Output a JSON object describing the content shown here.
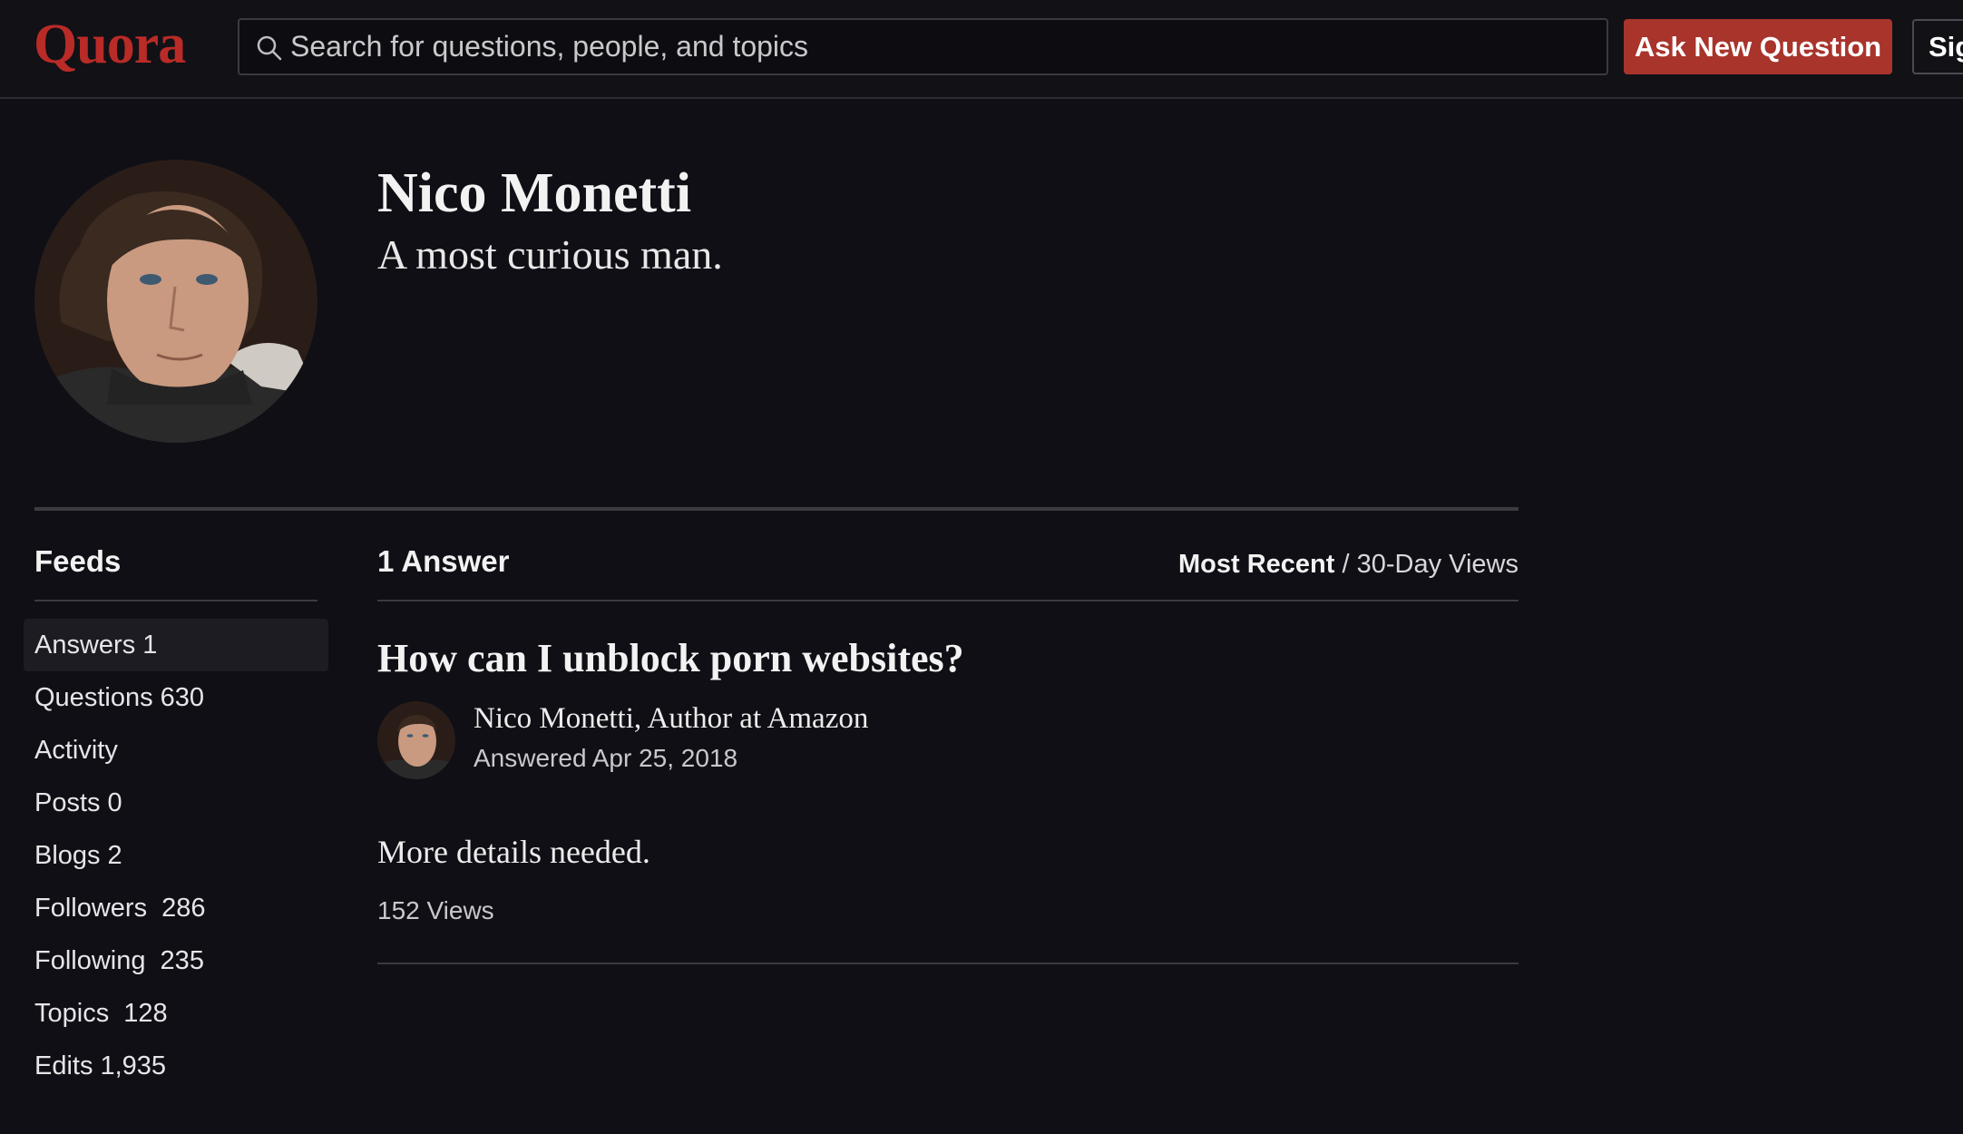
{
  "header": {
    "logo": "Quora",
    "search_placeholder": "Search for questions, people, and topics",
    "ask_button": "Ask New Question",
    "signin_button": "Sign In"
  },
  "profile": {
    "name": "Nico Monetti",
    "tagline": "A most curious man."
  },
  "feeds": {
    "title": "Feeds",
    "items": [
      {
        "label": "Answers",
        "count": "1",
        "active": true
      },
      {
        "label": "Questions",
        "count": "630"
      },
      {
        "label": "Activity",
        "count": ""
      },
      {
        "label": "Posts",
        "count": "0"
      },
      {
        "label": "Blogs",
        "count": "2"
      },
      {
        "label": "Followers",
        "count": " 286"
      },
      {
        "label": "Following",
        "count": " 235"
      },
      {
        "label": "Topics",
        "count": " 128"
      },
      {
        "label": "Edits",
        "count": "1,935"
      }
    ]
  },
  "content": {
    "answers_count": "1 Answer",
    "sort_active": "Most Recent",
    "sort_separator": " / ",
    "sort_other": "30-Day Views",
    "answer": {
      "question": "How can I unblock porn websites?",
      "author_credential": "Nico Monetti, Author at Amazon",
      "answered_date": "Answered Apr 25, 2018",
      "body": "More details needed.",
      "views": "152 Views"
    }
  },
  "colors": {
    "brand": "#b92b27",
    "ask_button_bg": "#a8342c",
    "background": "#0f0f15"
  }
}
